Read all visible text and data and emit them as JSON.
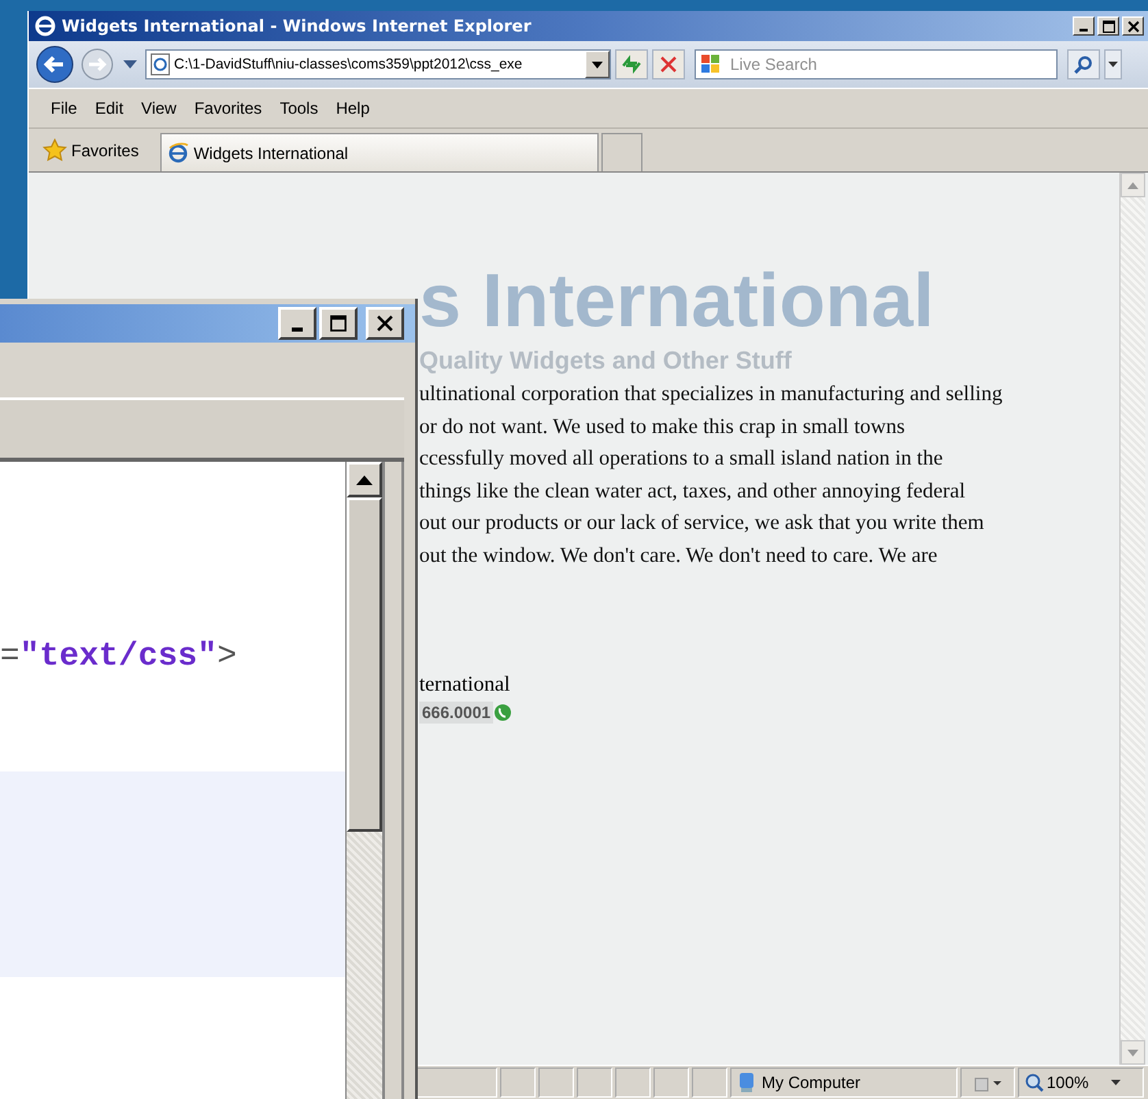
{
  "browser_window": {
    "title": "Widgets International - Windows Internet Explorer",
    "address": "C:\\1-DavidStuff\\niu-classes\\coms359\\ppt2012\\css_exe",
    "search": {
      "placeholder": "Live Search"
    },
    "menu": [
      "File",
      "Edit",
      "View",
      "Favorites",
      "Tools",
      "Help"
    ],
    "favorites_label": "Favorites",
    "tabs": [
      {
        "label": "Widgets International",
        "selected": true
      }
    ],
    "page": {
      "heading": "s International",
      "tagline": "Quality Widgets and Other Stuff",
      "paragraph_lines": [
        "ultinational corporation that specializes in manufacturing and selling",
        "or do not want. We used to make this crap in small towns",
        "ccessfully moved all operations to a small island nation in the",
        "things like the clean water act, taxes, and other annoying federal",
        "out our products or our lack of service, we ask that you write them",
        "out the window. We don't care. We don't need to care. We are"
      ],
      "footer_line": "ternational",
      "phone": "666.0001"
    },
    "status_bar": {
      "zone": "My Computer",
      "zoom": "100%"
    }
  },
  "editor_window": {
    "code_tokens": [
      {
        "text": "=",
        "kind": "punct"
      },
      {
        "text": "\"text/css\"",
        "kind": "string"
      },
      {
        "text": ">",
        "kind": "punct"
      }
    ]
  }
}
